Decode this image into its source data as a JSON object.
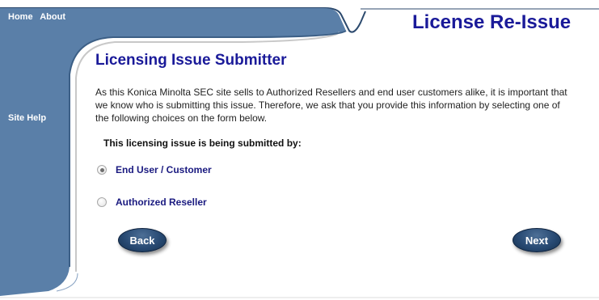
{
  "nav": {
    "home": "Home",
    "about": "About",
    "site_help": "Site Help"
  },
  "header": {
    "title": "License Re-Issue"
  },
  "main": {
    "section_title": "Licensing Issue Submitter",
    "intro_text": "As this Konica Minolta SEC site sells to Authorized Resellers and end user customers alike, it is important that we know who is submitting this issue. Therefore, we ask that you provide this information by selecting one of the following choices on the form below.",
    "question": "This licensing issue is being submitted by:",
    "options": [
      {
        "label": "End User / Customer",
        "selected": true
      },
      {
        "label": "Authorized Reseller",
        "selected": false
      }
    ]
  },
  "buttons": {
    "back": "Back",
    "next": "Next"
  },
  "colors": {
    "frame": "#5a7fa8",
    "frame_dark": "#3c5f86",
    "title": "#1a1a99",
    "button": "#284a73"
  }
}
